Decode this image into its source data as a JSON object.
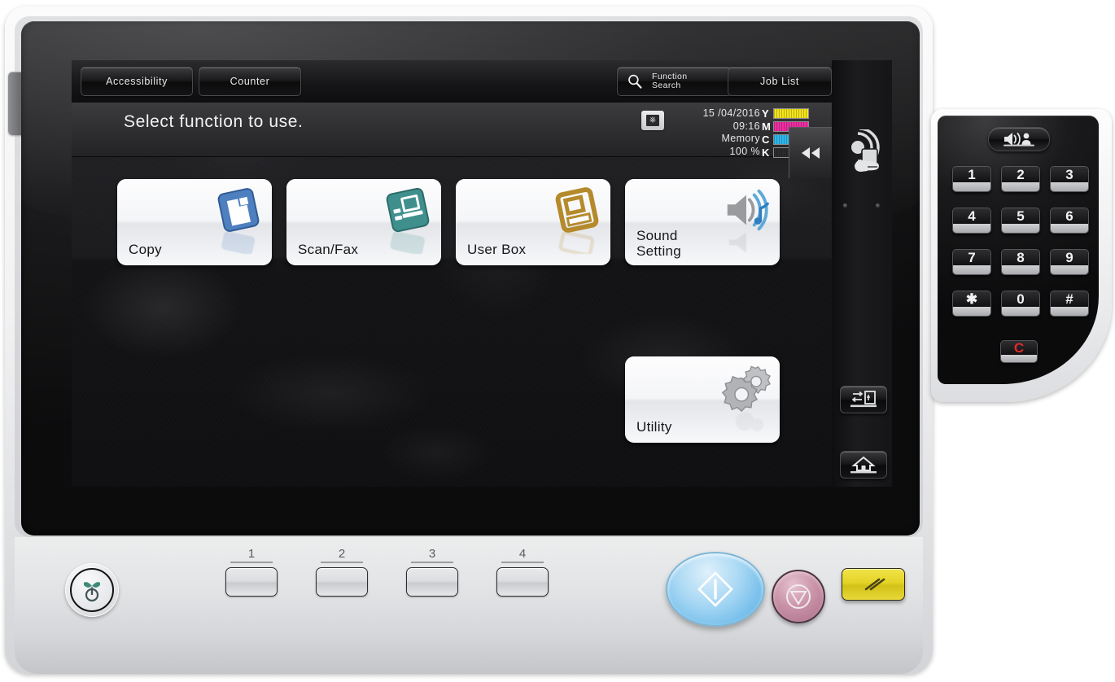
{
  "device": {
    "name": "multifunction-printer-control-panel"
  },
  "screen": {
    "toolbar": {
      "accessibility_label": "Accessibility",
      "counter_label": "Counter",
      "function_search_line1": "Function",
      "function_search_line2": "Search",
      "job_list_label": "Job List",
      "search_icon": "search-icon"
    },
    "status": {
      "message": "Select function to use.",
      "usb_icon": "usb-memory-icon",
      "date": "15 /04/2016",
      "time": "09:16",
      "memory_label": "Memory",
      "memory_value": "100 %",
      "collapse_icon": "double-left-arrow-icon",
      "toner": [
        {
          "letter": "Y",
          "color": "#f2e31e"
        },
        {
          "letter": "M",
          "color": "#ec2fa2"
        },
        {
          "letter": "C",
          "color": "#30b7ea"
        },
        {
          "letter": "K",
          "color": "#2b2b2d"
        }
      ]
    },
    "tiles": [
      {
        "id": "copy",
        "label": "Copy",
        "icon": "copy-icon",
        "color": "#3f6eb0"
      },
      {
        "id": "scanfax",
        "label": "Scan/Fax",
        "icon": "scan-fax-icon",
        "color": "#3e8e8c"
      },
      {
        "id": "userbox",
        "label": "User Box",
        "icon": "user-box-icon",
        "color": "#b58a2b"
      },
      {
        "id": "sound",
        "label": "Sound\nSetting",
        "icon": "sound-icon",
        "color": "#8f9093"
      },
      {
        "id": "utility",
        "label": "Utility",
        "icon": "gear-icon",
        "color": "#9a9b9e"
      }
    ],
    "tile_labels": {
      "copy": "Copy",
      "scanfax": "Scan/Fax",
      "userbox": "User Box",
      "sound_line1": "Sound",
      "sound_line2": "Setting",
      "utility": "Utility"
    }
  },
  "side_keys": {
    "access_icon": "access-login-icon",
    "home_icon": "home-icon",
    "nfc_icon": "nfc-touch-icon"
  },
  "keypad": {
    "volume_key_icon": "volume-accessibility-icon",
    "keys": [
      "1",
      "2",
      "3",
      "4",
      "5",
      "6",
      "7",
      "8",
      "9",
      "*",
      "0",
      "#"
    ],
    "clear_key": "C"
  },
  "bottom_panel": {
    "eco_button_icon": "eco-power-icon",
    "register_keys": [
      "1",
      "2",
      "3",
      "4"
    ],
    "start_button": {
      "icon": "start-diamond-icon",
      "color": "#7cc2ec"
    },
    "stop_button": {
      "icon": "stop-triangle-icon",
      "color": "#ca93a8"
    },
    "reset_button": {
      "icon": "reset-slashes-icon",
      "color": "#e4d327"
    }
  }
}
